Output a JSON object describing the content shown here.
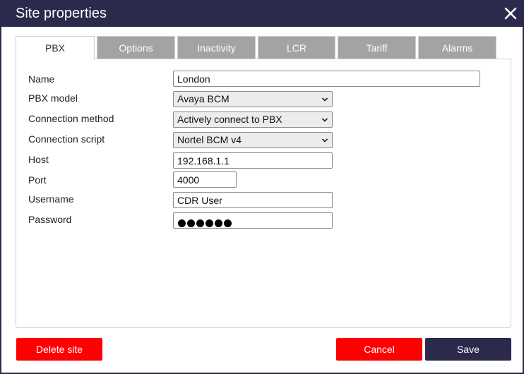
{
  "window": {
    "title": "Site properties"
  },
  "tabs": [
    {
      "label": "PBX",
      "active": true
    },
    {
      "label": "Options",
      "active": false
    },
    {
      "label": "Inactivity",
      "active": false
    },
    {
      "label": "LCR",
      "active": false
    },
    {
      "label": "Tariff",
      "active": false
    },
    {
      "label": "Alarms",
      "active": false
    }
  ],
  "form": {
    "name": {
      "label": "Name",
      "value": "London"
    },
    "pbx_model": {
      "label": "PBX model",
      "value": "Avaya BCM"
    },
    "connection_method": {
      "label": "Connection method",
      "value": "Actively connect to PBX"
    },
    "connection_script": {
      "label": "Connection script",
      "value": "Nortel BCM v4"
    },
    "host": {
      "label": "Host",
      "value": "192.168.1.1"
    },
    "port": {
      "label": "Port",
      "value": "4000"
    },
    "username": {
      "label": "Username",
      "value": "CDR User"
    },
    "password": {
      "label": "Password",
      "masked_length": 6
    }
  },
  "buttons": {
    "delete": "Delete site",
    "cancel": "Cancel",
    "save": "Save"
  },
  "colors": {
    "titlebar": "#2b2a4c",
    "tab_inactive": "#a3a3a3",
    "danger": "#ff0000",
    "primary": "#2b2a4c"
  },
  "icons": {
    "close": "close-icon",
    "dropdown": "chevron-down-icon"
  }
}
